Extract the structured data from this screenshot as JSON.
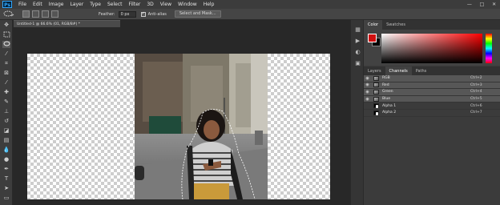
{
  "app": {
    "logo": "Ps"
  },
  "menu": [
    "File",
    "Edit",
    "Image",
    "Layer",
    "Type",
    "Select",
    "Filter",
    "3D",
    "View",
    "Window",
    "Help"
  ],
  "window_controls": {
    "minimize": "—",
    "maximize": "□",
    "close": "✕"
  },
  "options": {
    "feather_label": "Feather:",
    "feather_value": "0 px",
    "antialias_label": "Anti-alias",
    "select_mask_label": "Select and Mask..."
  },
  "document": {
    "tab_title": "Untitled-1 @ 66.6% (01, RGB/8#) *"
  },
  "color_panel": {
    "tabs": [
      "Color",
      "Swatches"
    ],
    "foreground": "#d01010",
    "background": "#000000"
  },
  "channels_panel": {
    "tabs": [
      "Layers",
      "Channels",
      "Paths"
    ],
    "rows": [
      {
        "name": "RGB",
        "shortcut": "Ctrl+2",
        "visible": true,
        "type": "color"
      },
      {
        "name": "Red",
        "shortcut": "Ctrl+3",
        "visible": true,
        "type": "color"
      },
      {
        "name": "Green",
        "shortcut": "Ctrl+4",
        "visible": true,
        "type": "color"
      },
      {
        "name": "Blue",
        "shortcut": "Ctrl+5",
        "visible": true,
        "type": "color"
      },
      {
        "name": "Alpha 1",
        "shortcut": "Ctrl+6",
        "visible": false,
        "type": "alpha"
      },
      {
        "name": "Alpha 2",
        "shortcut": "Ctrl+7",
        "visible": false,
        "type": "alpha"
      }
    ]
  }
}
